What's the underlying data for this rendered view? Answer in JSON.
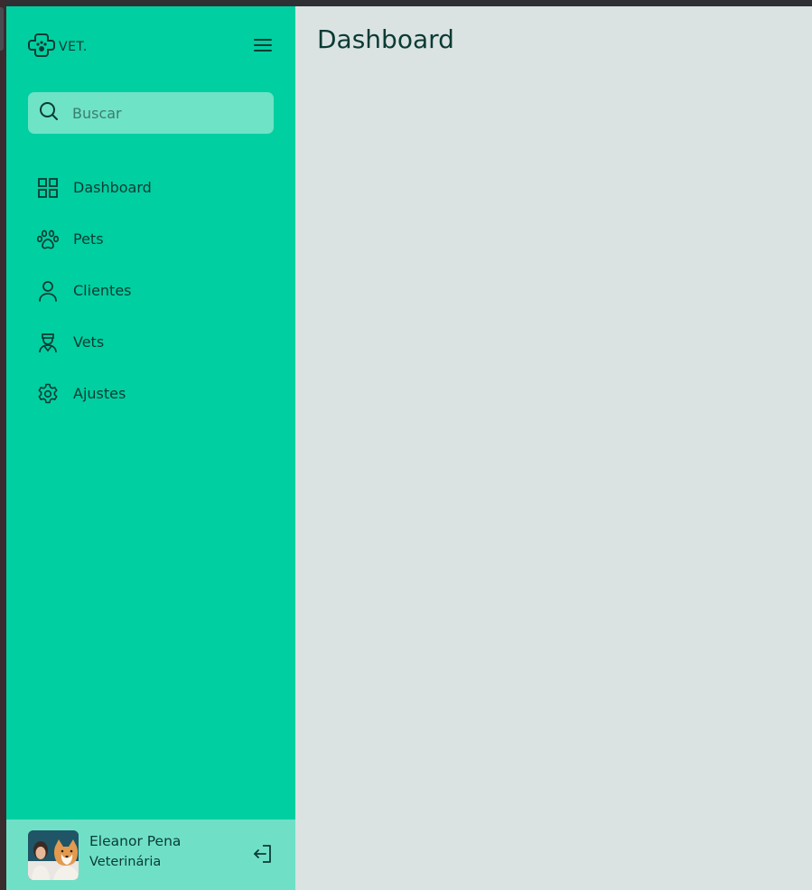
{
  "brand": {
    "name": "VET.",
    "icon": "paw-plus-icon"
  },
  "search": {
    "placeholder": "Buscar",
    "value": ""
  },
  "sidebar": {
    "items": [
      {
        "label": "Dashboard",
        "icon": "grid-icon"
      },
      {
        "label": "Pets",
        "icon": "paw-icon"
      },
      {
        "label": "Clientes",
        "icon": "user-icon"
      },
      {
        "label": "Vets",
        "icon": "vet-icon"
      },
      {
        "label": "Ajustes",
        "icon": "gear-icon"
      }
    ]
  },
  "user": {
    "name": "Eleanor Pena",
    "role": "Veterinária"
  },
  "main": {
    "title": "Dashboard"
  },
  "colors": {
    "sidebar": "#00cfa1",
    "search_bg": "#6fe3c6",
    "profile_bg": "#6fe0c6",
    "main_bg": "#dbe3e2",
    "text_dark": "#0b3b34"
  }
}
